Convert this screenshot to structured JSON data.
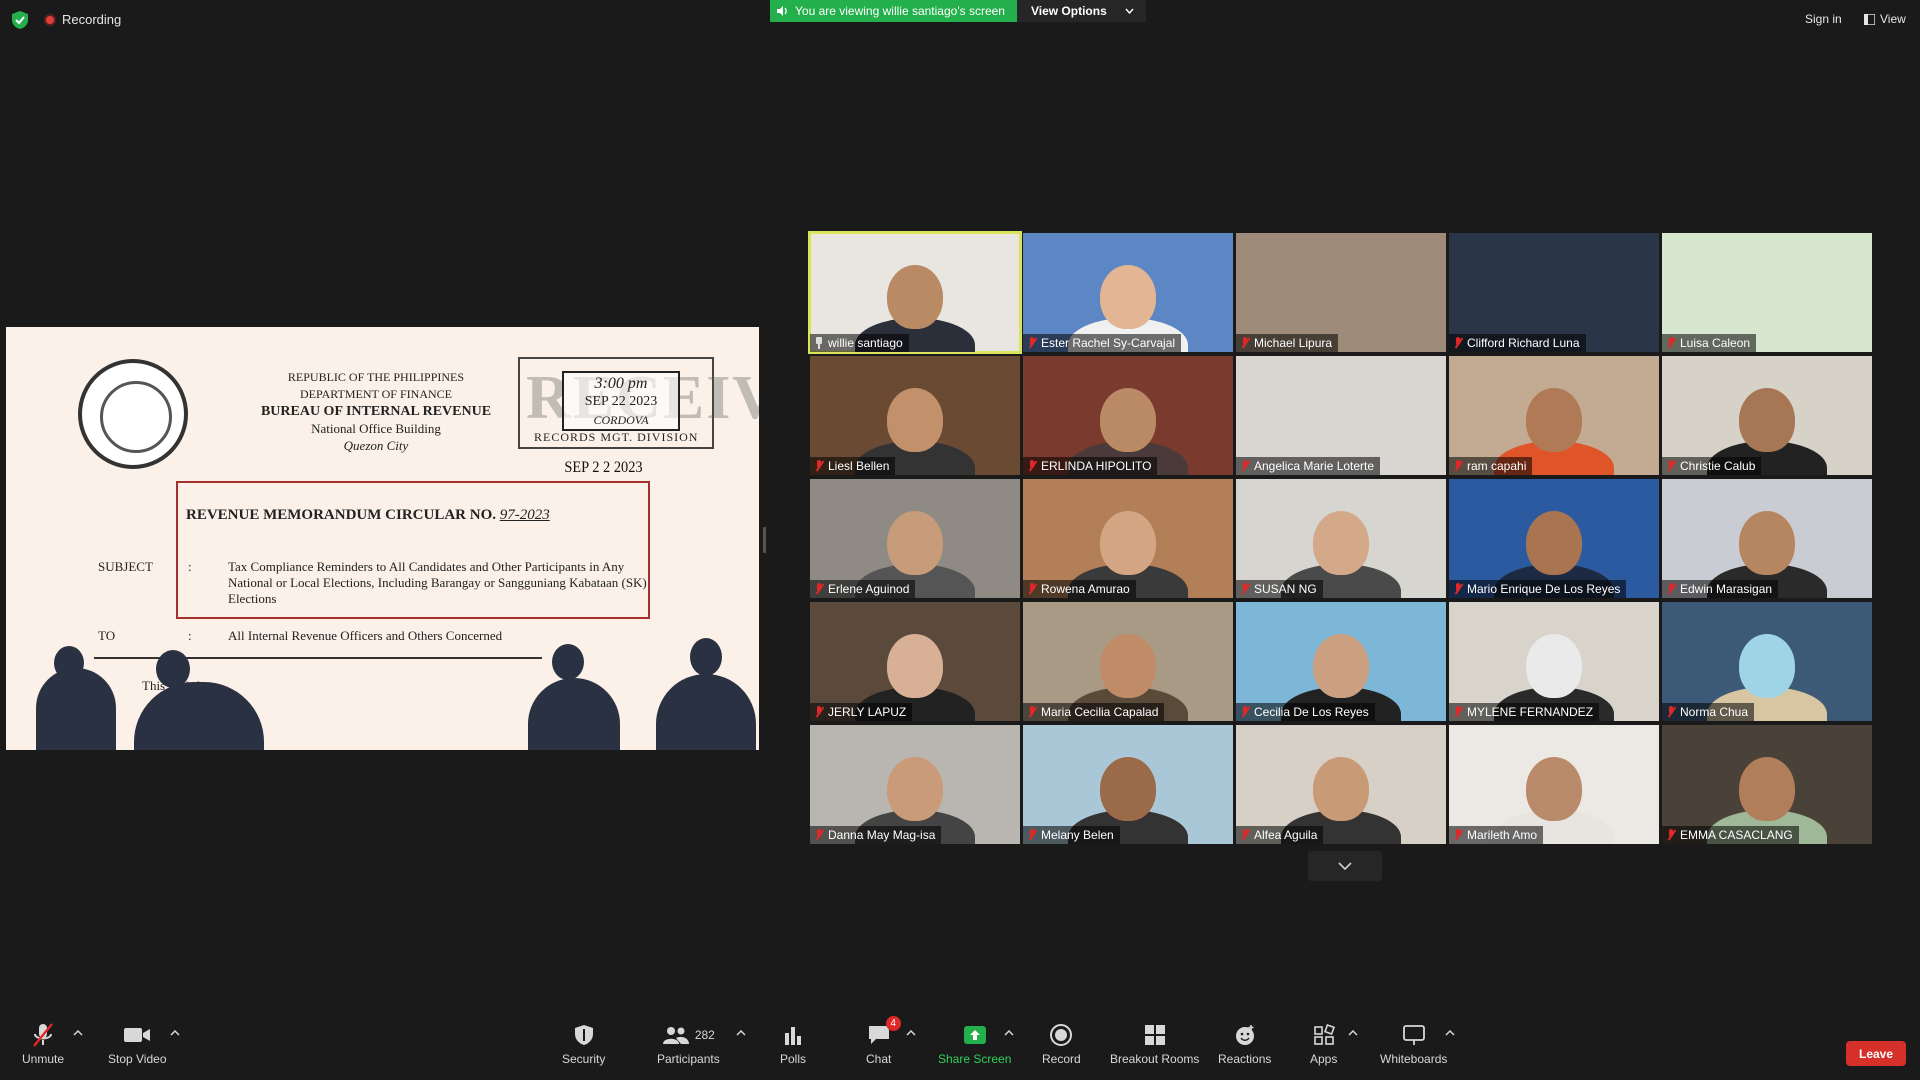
{
  "top": {
    "recording_label": "Recording",
    "banner_text": "You are viewing willie santiago's screen",
    "view_options_label": "View Options",
    "signin_label": "Sign in",
    "view_label": "View"
  },
  "document": {
    "header_line1": "REPUBLIC OF THE PHILIPPINES",
    "header_line2": "DEPARTMENT OF FINANCE",
    "header_line3": "BUREAU OF INTERNAL REVENUE",
    "header_line4": "National Office Building",
    "header_line5": "Quezon City",
    "stamp_word": "RECEIVED",
    "stamp_time": "3:00 pm",
    "stamp_date": "SEP 22 2023",
    "stamp_name": "CORDOVA",
    "stamp_footer": "RECORDS MGT. DIVISION",
    "date_line": "SEP 2 2 2023",
    "rmc_title": "REVENUE MEMORANDUM CIRCULAR NO.",
    "rmc_number": "97-2023",
    "subject_label": "SUBJECT",
    "colon": ":",
    "subject_text": "Tax Compliance Reminders to All Candidates and Other Participants in Any National or Local Elections, Including Barangay or Sangguniang Kabataan (SK) Elections",
    "to_label": "TO",
    "to_text": "All Internal Revenue Officers and Others Concerned",
    "body_start": "This    lar is b"
  },
  "participants": [
    {
      "name": "willie santiago",
      "muted": false,
      "pinned": true,
      "bg": "#e9e6e1",
      "skin": "#b98a63",
      "shirt": "#2b2f3a"
    },
    {
      "name": "Ester Rachel Sy-Carvajal",
      "muted": true,
      "bg": "#5d86c4",
      "skin": "#e3b592",
      "shirt": "#f0f0f0"
    },
    {
      "name": "Michael Lipura",
      "muted": true,
      "bg": "#9d8a78",
      "skin": null,
      "shirt": null
    },
    {
      "name": "Clifford Richard Luna",
      "muted": true,
      "bg": "#2a3648",
      "skin": null,
      "shirt": null
    },
    {
      "name": "Luisa Caleon",
      "muted": true,
      "bg": "#d7e6cf",
      "skin": null,
      "shirt": null
    },
    {
      "name": "Liesl Bellen",
      "muted": true,
      "bg": "#6b4a34",
      "skin": "#c2916c",
      "shirt": "#333"
    },
    {
      "name": "ERLINDA HIPOLITO",
      "muted": true,
      "bg": "#7a3a2e",
      "skin": "#b98a63",
      "shirt": "#4a3a3a"
    },
    {
      "name": "Angelica Marie Loterte",
      "muted": true,
      "bg": "#d9d6d1",
      "skin": null,
      "shirt": null
    },
    {
      "name": "ram capahi",
      "muted": true,
      "bg": "#c3aa92",
      "skin": "#b07a56",
      "shirt": "#e0542a"
    },
    {
      "name": "Christie Calub",
      "muted": true,
      "bg": "#d7d2c8",
      "skin": "#a77654",
      "shirt": "#222"
    },
    {
      "name": "Erlene Aguinod",
      "muted": true,
      "bg": "#8f8a84",
      "skin": "#c79c7a",
      "shirt": "#555"
    },
    {
      "name": "Rowena Amurao",
      "muted": true,
      "bg": "#b27f58",
      "skin": "#d4a582",
      "shirt": "#3a3a3a"
    },
    {
      "name": "SUSAN NG",
      "muted": true,
      "bg": "#d7d5d0",
      "skin": "#d3a98a",
      "shirt": "#4a4a4a"
    },
    {
      "name": "Mario Enrique De Los Reyes",
      "muted": true,
      "bg": "#2c5aa0",
      "skin": "#a87550",
      "shirt": "#1d2a44"
    },
    {
      "name": "Edwin Marasigan",
      "muted": true,
      "bg": "#c9cdd3",
      "skin": "#b68660",
      "shirt": "#2a2a2a"
    },
    {
      "name": "JERLY LAPUZ",
      "muted": true,
      "bg": "#5b4a3c",
      "skin": "#d8b095",
      "shirt": "#222"
    },
    {
      "name": "Maria Cecilia Capalad",
      "muted": true,
      "bg": "#a89a84",
      "skin": "#c08b67",
      "shirt": "#5a4a3a"
    },
    {
      "name": "Cecilia De Los Reyes",
      "muted": true,
      "bg": "#7cb7d8",
      "skin": "#caa081",
      "shirt": "#222"
    },
    {
      "name": "MYLENE FERNANDEZ",
      "muted": true,
      "bg": "#d8d4cc",
      "skin": "#eaeaea",
      "shirt": "#2a2a2a"
    },
    {
      "name": "Norma Chua",
      "muted": true,
      "bg": "#3c5a78",
      "skin": "#9fd3e6",
      "shirt": "#d8c6a3"
    },
    {
      "name": "Danna May Mag-isa",
      "muted": true,
      "bg": "#b9b6b2",
      "skin": "#c99b78",
      "shirt": "#444"
    },
    {
      "name": "Melany Belen",
      "muted": true,
      "bg": "#a9c7d6",
      "skin": "#9b6a48",
      "shirt": "#333"
    },
    {
      "name": "Alfea Aguila",
      "muted": true,
      "bg": "#d6d0c6",
      "skin": "#c99a76",
      "shirt": "#333"
    },
    {
      "name": "Marileth Amo",
      "muted": true,
      "bg": "#ece9e4",
      "skin": "#b98b6a",
      "shirt": "#e8e4df"
    },
    {
      "name": "EMMA CASACLANG",
      "muted": true,
      "bg": "#4a4238",
      "skin": "#b07e5b",
      "shirt": "#9fb898"
    }
  ],
  "toolbar": {
    "unmute": "Unmute",
    "stop_video": "Stop Video",
    "security": "Security",
    "participants": "Participants",
    "participant_count": "282",
    "polls": "Polls",
    "chat": "Chat",
    "chat_badge": "4",
    "share_screen": "Share Screen",
    "record": "Record",
    "breakout_rooms": "Breakout Rooms",
    "reactions": "Reactions",
    "apps": "Apps",
    "whiteboards": "Whiteboards",
    "leave": "Leave"
  },
  "colors": {
    "background": "#1a1a1a",
    "banner_green": "#23b04c",
    "active_speaker": "#d9e45a",
    "leave_red": "#d6302a",
    "muted_red": "#e02828"
  }
}
